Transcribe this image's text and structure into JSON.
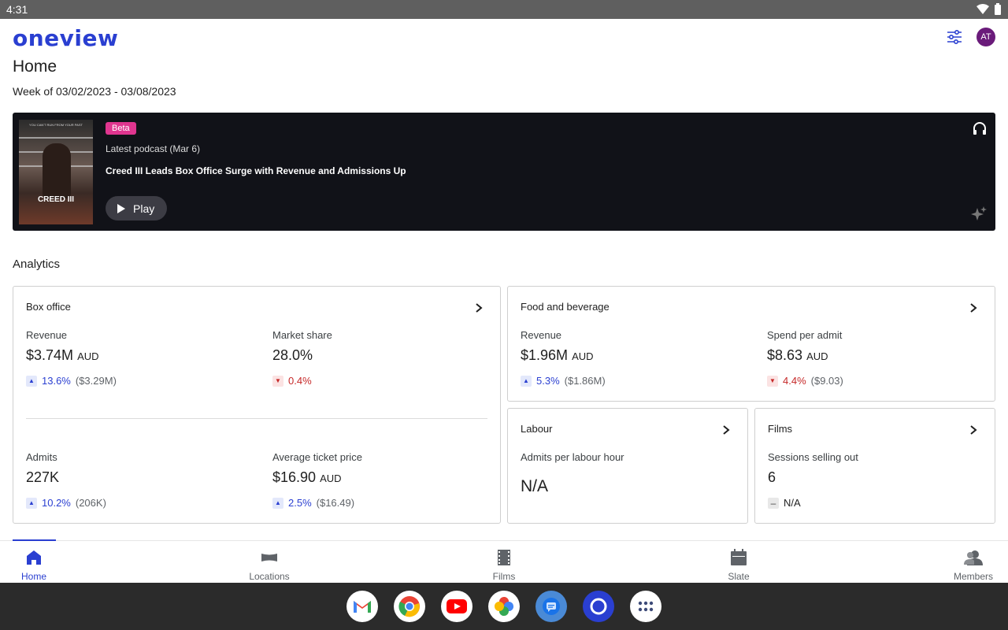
{
  "status_bar": {
    "time": "4:31"
  },
  "app": {
    "logo": "oneview",
    "avatar_initials": "AT"
  },
  "page": {
    "title": "Home",
    "week": "Week of 03/02/2023 - 03/08/2023"
  },
  "podcast": {
    "badge": "Beta",
    "latest": "Latest podcast (Mar 6)",
    "headline": "Creed III Leads Box Office Surge with Revenue and Admissions Up",
    "play_label": "Play",
    "poster_title": "CREED III",
    "poster_tagline": "YOU CAN'T RUN FROM YOUR PAST"
  },
  "analytics": {
    "title": "Analytics",
    "box_office": {
      "title": "Box office",
      "revenue": {
        "label": "Revenue",
        "value": "$3.74M",
        "unit": "AUD",
        "direction": "up",
        "change": "13.6%",
        "previous": "($3.29M)"
      },
      "market_share": {
        "label": "Market share",
        "value": "28.0%",
        "direction": "down",
        "change": "0.4%"
      },
      "admits": {
        "label": "Admits",
        "value": "227K",
        "direction": "up",
        "change": "10.2%",
        "previous": "(206K)"
      },
      "avg_ticket": {
        "label": "Average ticket price",
        "value": "$16.90",
        "unit": "AUD",
        "direction": "up",
        "change": "2.5%",
        "previous": "($16.49)"
      }
    },
    "food_beverage": {
      "title": "Food and beverage",
      "revenue": {
        "label": "Revenue",
        "value": "$1.96M",
        "unit": "AUD",
        "direction": "up",
        "change": "5.3%",
        "previous": "($1.86M)"
      },
      "spend_per_admit": {
        "label": "Spend per admit",
        "value": "$8.63",
        "unit": "AUD",
        "direction": "down",
        "change": "4.4%",
        "previous": "($9.03)"
      }
    },
    "labour": {
      "title": "Labour",
      "admits_per_hour": {
        "label": "Admits per labour hour",
        "value": "N/A"
      }
    },
    "films": {
      "title": "Films",
      "sessions_selling_out": {
        "label": "Sessions selling out",
        "value": "6",
        "direction": "flat",
        "change": "N/A"
      }
    }
  },
  "bottom_nav": {
    "home": "Home",
    "locations": "Locations",
    "films": "Films",
    "slate": "Slate",
    "members": "Members"
  },
  "colors": {
    "brand": "#2a3fd1",
    "banner_bg": "#111218",
    "beta_badge": "#e0358f",
    "avatar": "#6a1b7a",
    "negative": "#c62828"
  },
  "dock": {
    "apps": [
      "gmail-icon",
      "chrome-icon",
      "youtube-icon",
      "photos-icon",
      "messages-icon",
      "app-icon",
      "app-drawer-icon"
    ]
  }
}
